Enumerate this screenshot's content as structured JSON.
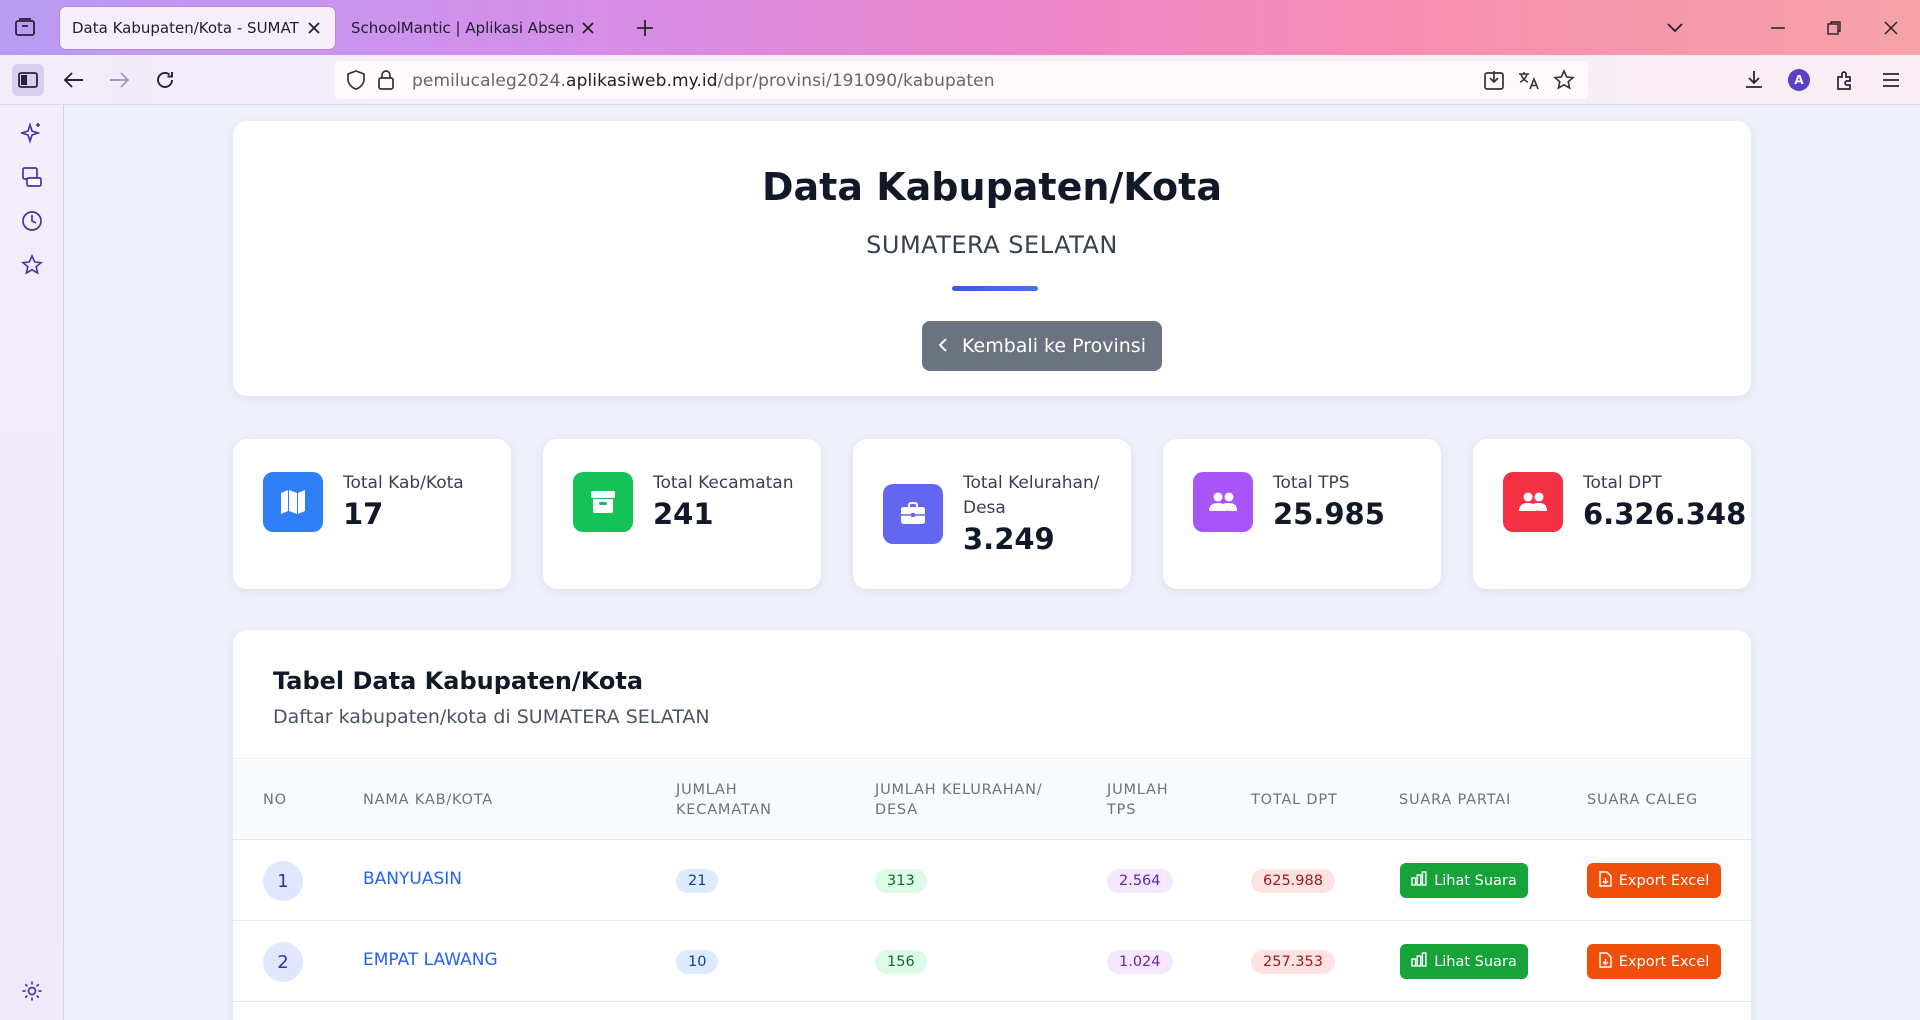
{
  "browser": {
    "tabs": [
      {
        "title": "Data Kabupaten/Kota - SUMATERA SELATAN",
        "active": true
      },
      {
        "title": "SchoolMantic | Aplikasi Absensi Sekolah",
        "active": false
      }
    ],
    "url": {
      "prefix": "pemilucaleg2024.",
      "host": "aplikasiweb.my.id",
      "path": "/dpr/provinsi/191090/kabupaten"
    },
    "profile_initial": "A",
    "sidebar_icons": [
      "ai-sparkle-icon",
      "synced-tabs-icon",
      "history-icon",
      "bookmarks-icon",
      "settings-icon"
    ]
  },
  "header": {
    "title": "Data Kabupaten/Kota",
    "subtitle": "SUMATERA SELATAN",
    "back_button_label": "Kembali ke Provinsi"
  },
  "stats": [
    {
      "label": "Total Kab/Kota",
      "value": "17",
      "color": "#2f7ef6",
      "icon": "map-icon"
    },
    {
      "label": "Total Kecamatan",
      "value": "241",
      "color": "#14c257",
      "icon": "archive-icon"
    },
    {
      "label": "Total Kelurahan/ Desa",
      "value": "3.249",
      "color": "#6366f1",
      "icon": "briefcase-icon"
    },
    {
      "label": "Total TPS",
      "value": "25.985",
      "color": "#a855f7",
      "icon": "users-icon"
    },
    {
      "label": "Total DPT",
      "value": "6.326.348",
      "color": "#f43045",
      "icon": "users-icon"
    }
  ],
  "table": {
    "title": "Tabel Data Kabupaten/Kota",
    "description": "Daftar kabupaten/kota di SUMATERA SELATAN",
    "headers": {
      "no": "NO",
      "nama": "NAMA KAB/KOTA",
      "kec_1": "JUMLAH",
      "kec_2": "KECAMATAN",
      "kel_1": "JUMLAH KELURAHAN/",
      "kel_2": "DESA",
      "tps_1": "JUMLAH",
      "tps_2": "TPS",
      "dpt": "TOTAL DPT",
      "partai": "SUARA PARTAI",
      "caleg": "SUARA CALEG"
    },
    "rows": [
      {
        "no": "1",
        "nama": "BANYUASIN",
        "kecamatan": "21",
        "kelurahan": "313",
        "tps": "2.564",
        "dpt": "625.988",
        "lihat_label": "Lihat Suara",
        "export_label": "Export Excel"
      },
      {
        "no": "2",
        "nama": "EMPAT LAWANG",
        "kecamatan": "10",
        "kelurahan": "156",
        "tps": "1.024",
        "dpt": "257.353",
        "lihat_label": "Lihat Suara",
        "export_label": "Export Excel"
      }
    ]
  }
}
